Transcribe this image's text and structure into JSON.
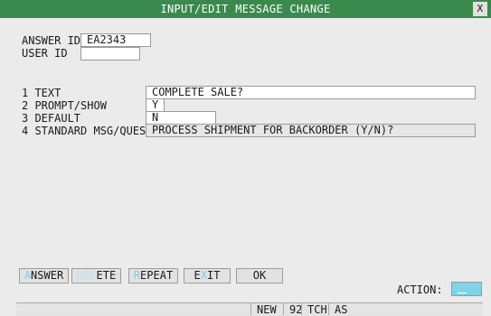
{
  "window": {
    "title": "INPUT/EDIT MESSAGE CHANGE",
    "close_label": "X"
  },
  "header": {
    "answer_id_label": "ANSWER ID",
    "answer_id_value": "EA2343",
    "user_id_label": "USER ID",
    "user_id_value": ""
  },
  "fields": [
    {
      "label": "1 TEXT",
      "value": "COMPLETE SALE?"
    },
    {
      "label": "2 PROMPT/SHOW",
      "value": "Y"
    },
    {
      "label": "3 DEFAULT",
      "value": "N"
    },
    {
      "label": "4 STANDARD MSG/QUES",
      "value": "PROCESS SHIPMENT FOR BACKORDER (Y/N)?"
    }
  ],
  "buttons": {
    "answer": {
      "hotkey": "A",
      "rest": "NSWER"
    },
    "delete": {
      "hotkey": "DEL",
      "rest": "ETE"
    },
    "repeat": {
      "hotkey": "R",
      "rest": "EPEAT"
    },
    "exit": {
      "pre": "E",
      "hotkey": "X",
      "rest": "IT"
    },
    "ok": {
      "label": "OK"
    }
  },
  "action": {
    "label": "ACTION:",
    "value": ""
  },
  "status": {
    "seg1": "NEW",
    "seg2": "92",
    "seg3": "TCH",
    "seg4": "AS"
  },
  "colors": {
    "title_bg": "#3a8a4e",
    "hotkey": "#7ad0e6",
    "action_bg": "#7fd3e6"
  }
}
